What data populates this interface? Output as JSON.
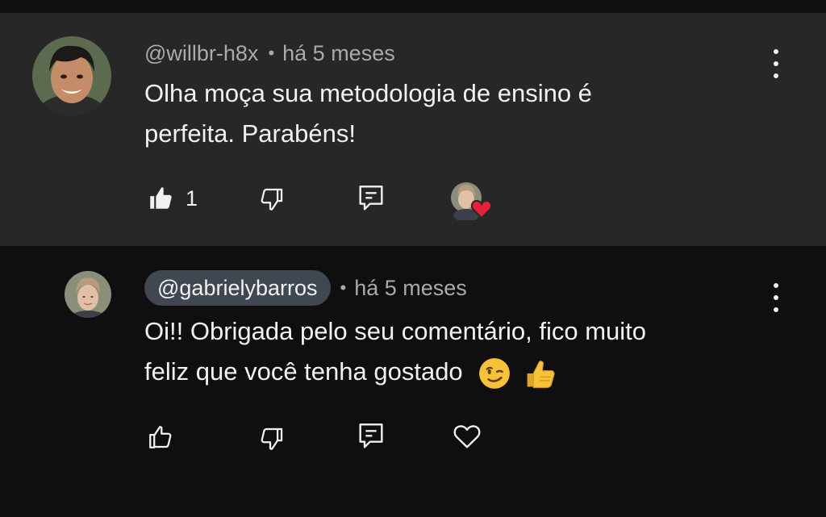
{
  "comments": [
    {
      "author": "@willbr-h8x",
      "separator": "•",
      "time": "há 5 meses",
      "text_line1": "Olha moça sua metodologia de ensino é",
      "text_line2": "perfeita. Parabéns!",
      "like_count": "1",
      "liked": true,
      "creator_heart": true
    },
    {
      "author": "@gabrielybarros",
      "separator": "•",
      "time": "há 5 meses",
      "text_line1": "Oi!! Obrigada pelo seu comentário, fico muito",
      "text_line2": "feliz que você tenha gostado",
      "emojis": [
        "winking-face",
        "thumbs-up"
      ],
      "liked": false
    }
  ],
  "colors": {
    "highlight_bg": "#272727",
    "page_bg": "#0f0f0f",
    "heart": "#e8203a",
    "chip_bg": "#3f4750"
  }
}
